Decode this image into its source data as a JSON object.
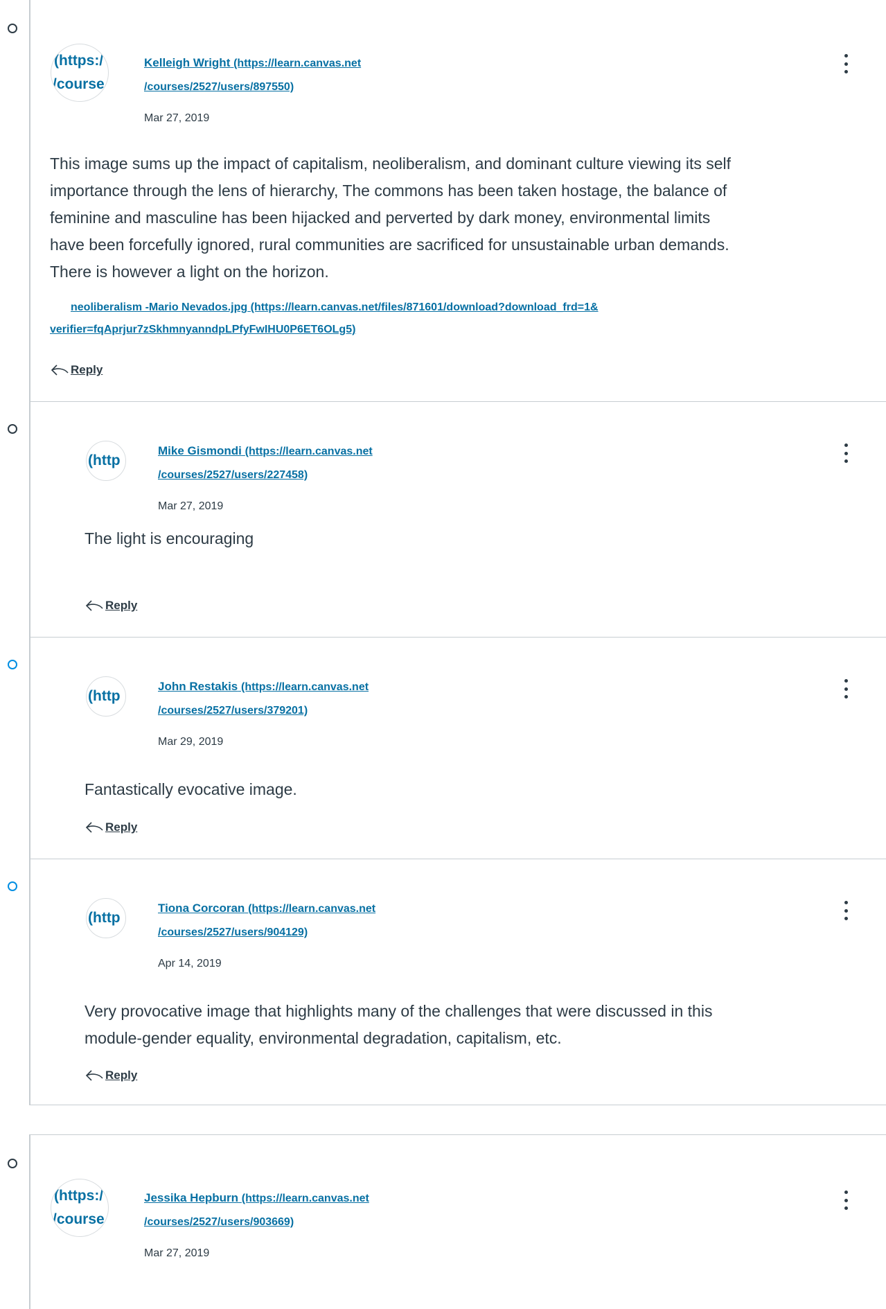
{
  "entries": [
    {
      "avatar_lines": [
        "(https:/",
        "/course"
      ],
      "author_name": "Kelleigh Wright",
      "author_url_1": "(https://learn.canvas.net",
      "author_url_2": "/courses/2527/users/897550)",
      "date": "Mar 27, 2019",
      "message_lines": [
        "This image sums up the impact of capitalism, neoliberalism, and dominant culture viewing its self",
        "importance through the lens of hierarchy, The commons has been taken hostage, the balance of",
        "feminine and masculine has been hijacked and perverted by dark money, environmental limits",
        "have been forcefully ignored, rural communities are sacrificed for unsustainable urban demands.",
        "There is however a light on the horizon."
      ],
      "attachment_name": "neoliberalism -Mario Nevados.jpg",
      "attachment_url_1": "(https://learn.canvas.net/files/871601/download?download_frd=1&",
      "attachment_url_2": "verifier=fqAprjur7zSkhmnyanndpLPfyFwIHU0P6ET6OLg5)",
      "reply_label": "Reply"
    },
    {
      "avatar_lines": [
        "(http"
      ],
      "author_name": "Mike Gismondi",
      "author_url_1": "(https://learn.canvas.net",
      "author_url_2": "/courses/2527/users/227458)",
      "date": "Mar 27, 2019",
      "message_lines": [
        "The light is encouraging"
      ],
      "reply_label": "Reply"
    },
    {
      "avatar_lines": [
        "(http"
      ],
      "author_name": "John Restakis",
      "author_url_1": "(https://learn.canvas.net",
      "author_url_2": "/courses/2527/users/379201)",
      "date": "Mar 29, 2019",
      "message_lines": [
        "Fantastically evocative image."
      ],
      "reply_label": "Reply"
    },
    {
      "avatar_lines": [
        "(http"
      ],
      "author_name": "Tiona Corcoran",
      "author_url_1": "(https://learn.canvas.net",
      "author_url_2": "/courses/2527/users/904129)",
      "date": "Apr 14, 2019",
      "message_lines": [
        "Very provocative image that highlights many of the challenges that were discussed in this",
        "module-gender equality, environmental degradation, capitalism, etc."
      ],
      "reply_label": "Reply"
    },
    {
      "avatar_lines": [
        "(https:/",
        "/course"
      ],
      "author_name": "Jessika Hepburn",
      "author_url_1": "(https://learn.canvas.net",
      "author_url_2": "/courses/2527/users/903669)",
      "date": "Mar 27, 2019"
    }
  ],
  "icons": {
    "bullet": "circle-bullet-icon",
    "menu": "kebab-menu-icon",
    "reply": "reply-arrow-icon"
  },
  "colors": {
    "link": "#0770a3",
    "unread": "#008ee2",
    "text": "#2d3b45",
    "border": "#c7cdd1"
  }
}
